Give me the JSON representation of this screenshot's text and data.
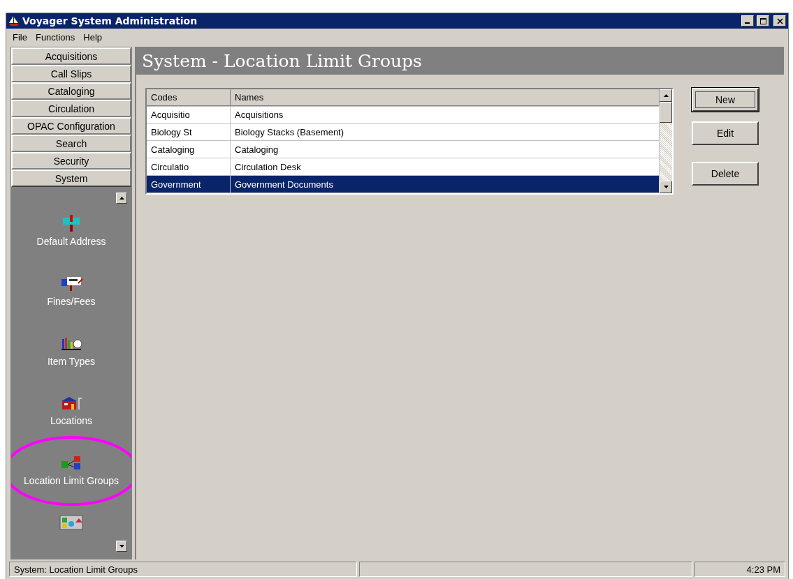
{
  "window": {
    "title": "Voyager System Administration"
  },
  "menu": [
    "File",
    "Functions",
    "Help"
  ],
  "modules": [
    {
      "label": "Acquisitions",
      "selected": false
    },
    {
      "label": "Call Slips",
      "selected": false
    },
    {
      "label": "Cataloging",
      "selected": false
    },
    {
      "label": "Circulation",
      "selected": false
    },
    {
      "label": "OPAC Configuration",
      "selected": false
    },
    {
      "label": "Search",
      "selected": false
    },
    {
      "label": "Security",
      "selected": false
    },
    {
      "label": "System",
      "selected": true
    }
  ],
  "sidebar": {
    "items": [
      {
        "kind": "mailbox",
        "label": "Default Address",
        "highlighted": false
      },
      {
        "kind": "fees",
        "label": "Fines/Fees",
        "highlighted": false
      },
      {
        "kind": "books",
        "label": "Item Types",
        "highlighted": false
      },
      {
        "kind": "house",
        "label": "Locations",
        "highlighted": false
      },
      {
        "kind": "groups",
        "label": "Location Limit Groups",
        "highlighted": true
      },
      {
        "kind": "misc",
        "highlighted": false
      }
    ]
  },
  "page_title": "System - Location Limit Groups",
  "table": {
    "columns": [
      "Codes",
      "Names"
    ],
    "rows": [
      {
        "cells": [
          "Acquisitio",
          "Acquisitions"
        ],
        "selected": false
      },
      {
        "cells": [
          "Biology St",
          "Biology Stacks (Basement)"
        ],
        "selected": false
      },
      {
        "cells": [
          "Cataloging",
          "Cataloging"
        ],
        "selected": false
      },
      {
        "cells": [
          "Circulatio",
          "Circulation Desk"
        ],
        "selected": false
      },
      {
        "cells": [
          "Government",
          "Government Documents"
        ],
        "selected": true
      }
    ]
  },
  "buttons": [
    {
      "label": "New",
      "focused": true
    },
    {
      "label": "Edit",
      "focused": false
    },
    {
      "label": "Delete",
      "focused": false
    }
  ],
  "status_bar": {
    "message": "System:  Location Limit Groups",
    "time": "4:23 PM"
  }
}
